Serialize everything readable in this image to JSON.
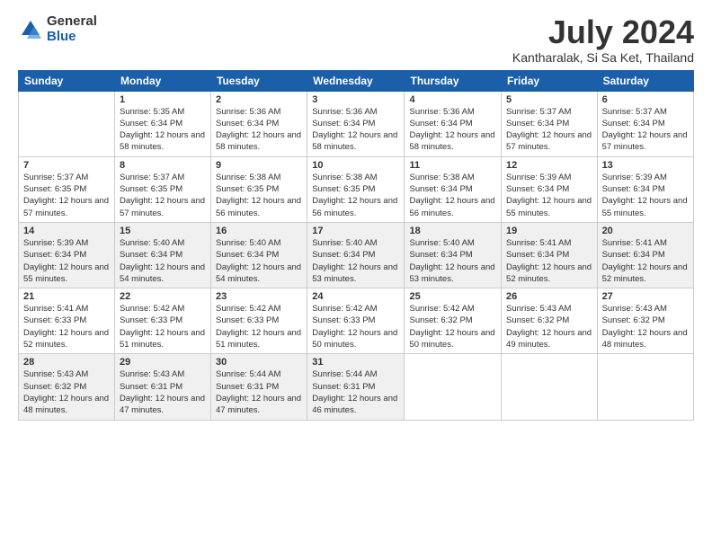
{
  "logo": {
    "general": "General",
    "blue": "Blue"
  },
  "title": "July 2024",
  "location": "Kantharalak, Si Sa Ket, Thailand",
  "weekdays": [
    "Sunday",
    "Monday",
    "Tuesday",
    "Wednesday",
    "Thursday",
    "Friday",
    "Saturday"
  ],
  "weeks": [
    [
      {
        "day": "",
        "sunrise": "",
        "sunset": "",
        "daylight": ""
      },
      {
        "day": "1",
        "sunrise": "Sunrise: 5:35 AM",
        "sunset": "Sunset: 6:34 PM",
        "daylight": "Daylight: 12 hours and 58 minutes."
      },
      {
        "day": "2",
        "sunrise": "Sunrise: 5:36 AM",
        "sunset": "Sunset: 6:34 PM",
        "daylight": "Daylight: 12 hours and 58 minutes."
      },
      {
        "day": "3",
        "sunrise": "Sunrise: 5:36 AM",
        "sunset": "Sunset: 6:34 PM",
        "daylight": "Daylight: 12 hours and 58 minutes."
      },
      {
        "day": "4",
        "sunrise": "Sunrise: 5:36 AM",
        "sunset": "Sunset: 6:34 PM",
        "daylight": "Daylight: 12 hours and 58 minutes."
      },
      {
        "day": "5",
        "sunrise": "Sunrise: 5:37 AM",
        "sunset": "Sunset: 6:34 PM",
        "daylight": "Daylight: 12 hours and 57 minutes."
      },
      {
        "day": "6",
        "sunrise": "Sunrise: 5:37 AM",
        "sunset": "Sunset: 6:34 PM",
        "daylight": "Daylight: 12 hours and 57 minutes."
      }
    ],
    [
      {
        "day": "7",
        "sunrise": "Sunrise: 5:37 AM",
        "sunset": "Sunset: 6:35 PM",
        "daylight": "Daylight: 12 hours and 57 minutes."
      },
      {
        "day": "8",
        "sunrise": "Sunrise: 5:37 AM",
        "sunset": "Sunset: 6:35 PM",
        "daylight": "Daylight: 12 hours and 57 minutes."
      },
      {
        "day": "9",
        "sunrise": "Sunrise: 5:38 AM",
        "sunset": "Sunset: 6:35 PM",
        "daylight": "Daylight: 12 hours and 56 minutes."
      },
      {
        "day": "10",
        "sunrise": "Sunrise: 5:38 AM",
        "sunset": "Sunset: 6:35 PM",
        "daylight": "Daylight: 12 hours and 56 minutes."
      },
      {
        "day": "11",
        "sunrise": "Sunrise: 5:38 AM",
        "sunset": "Sunset: 6:34 PM",
        "daylight": "Daylight: 12 hours and 56 minutes."
      },
      {
        "day": "12",
        "sunrise": "Sunrise: 5:39 AM",
        "sunset": "Sunset: 6:34 PM",
        "daylight": "Daylight: 12 hours and 55 minutes."
      },
      {
        "day": "13",
        "sunrise": "Sunrise: 5:39 AM",
        "sunset": "Sunset: 6:34 PM",
        "daylight": "Daylight: 12 hours and 55 minutes."
      }
    ],
    [
      {
        "day": "14",
        "sunrise": "Sunrise: 5:39 AM",
        "sunset": "Sunset: 6:34 PM",
        "daylight": "Daylight: 12 hours and 55 minutes."
      },
      {
        "day": "15",
        "sunrise": "Sunrise: 5:40 AM",
        "sunset": "Sunset: 6:34 PM",
        "daylight": "Daylight: 12 hours and 54 minutes."
      },
      {
        "day": "16",
        "sunrise": "Sunrise: 5:40 AM",
        "sunset": "Sunset: 6:34 PM",
        "daylight": "Daylight: 12 hours and 54 minutes."
      },
      {
        "day": "17",
        "sunrise": "Sunrise: 5:40 AM",
        "sunset": "Sunset: 6:34 PM",
        "daylight": "Daylight: 12 hours and 53 minutes."
      },
      {
        "day": "18",
        "sunrise": "Sunrise: 5:40 AM",
        "sunset": "Sunset: 6:34 PM",
        "daylight": "Daylight: 12 hours and 53 minutes."
      },
      {
        "day": "19",
        "sunrise": "Sunrise: 5:41 AM",
        "sunset": "Sunset: 6:34 PM",
        "daylight": "Daylight: 12 hours and 52 minutes."
      },
      {
        "day": "20",
        "sunrise": "Sunrise: 5:41 AM",
        "sunset": "Sunset: 6:34 PM",
        "daylight": "Daylight: 12 hours and 52 minutes."
      }
    ],
    [
      {
        "day": "21",
        "sunrise": "Sunrise: 5:41 AM",
        "sunset": "Sunset: 6:33 PM",
        "daylight": "Daylight: 12 hours and 52 minutes."
      },
      {
        "day": "22",
        "sunrise": "Sunrise: 5:42 AM",
        "sunset": "Sunset: 6:33 PM",
        "daylight": "Daylight: 12 hours and 51 minutes."
      },
      {
        "day": "23",
        "sunrise": "Sunrise: 5:42 AM",
        "sunset": "Sunset: 6:33 PM",
        "daylight": "Daylight: 12 hours and 51 minutes."
      },
      {
        "day": "24",
        "sunrise": "Sunrise: 5:42 AM",
        "sunset": "Sunset: 6:33 PM",
        "daylight": "Daylight: 12 hours and 50 minutes."
      },
      {
        "day": "25",
        "sunrise": "Sunrise: 5:42 AM",
        "sunset": "Sunset: 6:32 PM",
        "daylight": "Daylight: 12 hours and 50 minutes."
      },
      {
        "day": "26",
        "sunrise": "Sunrise: 5:43 AM",
        "sunset": "Sunset: 6:32 PM",
        "daylight": "Daylight: 12 hours and 49 minutes."
      },
      {
        "day": "27",
        "sunrise": "Sunrise: 5:43 AM",
        "sunset": "Sunset: 6:32 PM",
        "daylight": "Daylight: 12 hours and 48 minutes."
      }
    ],
    [
      {
        "day": "28",
        "sunrise": "Sunrise: 5:43 AM",
        "sunset": "Sunset: 6:32 PM",
        "daylight": "Daylight: 12 hours and 48 minutes."
      },
      {
        "day": "29",
        "sunrise": "Sunrise: 5:43 AM",
        "sunset": "Sunset: 6:31 PM",
        "daylight": "Daylight: 12 hours and 47 minutes."
      },
      {
        "day": "30",
        "sunrise": "Sunrise: 5:44 AM",
        "sunset": "Sunset: 6:31 PM",
        "daylight": "Daylight: 12 hours and 47 minutes."
      },
      {
        "day": "31",
        "sunrise": "Sunrise: 5:44 AM",
        "sunset": "Sunset: 6:31 PM",
        "daylight": "Daylight: 12 hours and 46 minutes."
      },
      {
        "day": "",
        "sunrise": "",
        "sunset": "",
        "daylight": ""
      },
      {
        "day": "",
        "sunrise": "",
        "sunset": "",
        "daylight": ""
      },
      {
        "day": "",
        "sunrise": "",
        "sunset": "",
        "daylight": ""
      }
    ]
  ]
}
